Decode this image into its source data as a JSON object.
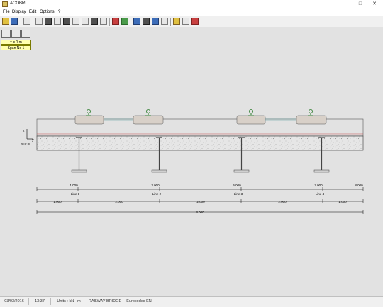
{
  "window": {
    "title": "ACOBRI"
  },
  "menu": [
    "File",
    "Display",
    "Edit",
    "Options",
    "?"
  ],
  "toolbar_icons": [
    "open-icon",
    "save-icon",
    "clipboard-icon",
    "sheet-icon",
    "deck-icon",
    "beam-icon",
    "truss-icon",
    "column-icon",
    "section-icon",
    "girder-icon",
    "load-icon",
    "grid-icon",
    "bar-chart-icon",
    "table-icon",
    "crane-icon",
    "monitor-icon",
    "people-icon",
    "fork-icon",
    "wheel-icon",
    "calc-icon",
    "report-icon"
  ],
  "section_buttons": [
    "beam-section-icon",
    "girder-section-icon",
    "slab-section-icon"
  ],
  "info": {
    "position": "x = 0 m",
    "span": "Span No 1"
  },
  "axes": {
    "z": "z",
    "y": "y",
    "origin": "y=0 m"
  },
  "rails": [
    "1.000",
    "3.000",
    "5.000",
    "7.000"
  ],
  "dim_top": [
    "1.000",
    "3.000",
    "5.000",
    "7.000",
    "8.000"
  ],
  "lines": [
    "Line 1",
    "Line 2",
    "Line 3",
    "Line 4"
  ],
  "dim_mid": [
    "1.000",
    "2.000",
    "2.000",
    "2.000",
    "1.000"
  ],
  "dim_total": "8.000",
  "status": {
    "date": "03/03/2016",
    "time": "13:37",
    "units": "Units : kN - m",
    "type": "RAILWAY BRIDGE",
    "code": "Eurocodes EN"
  }
}
